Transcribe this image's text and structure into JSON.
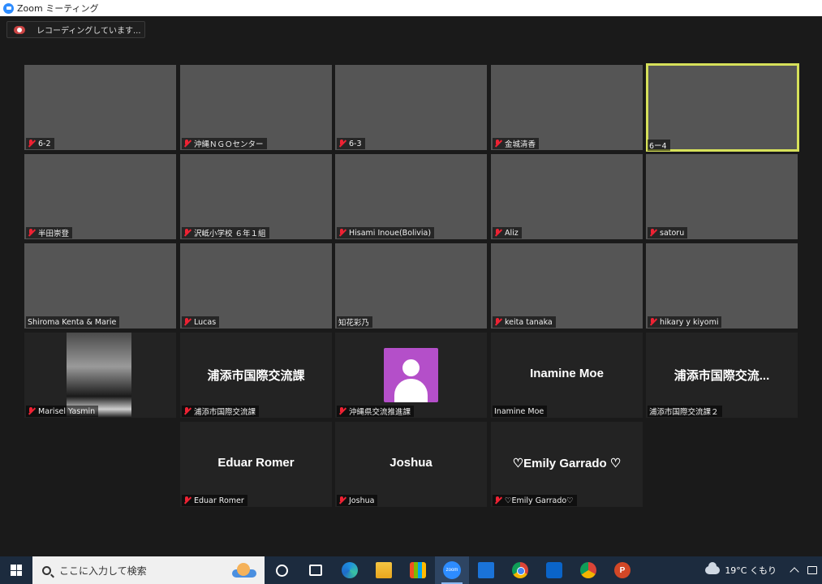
{
  "window": {
    "title": "Zoom ミーティング",
    "recording_status": "レコーディングしています..."
  },
  "tiles": [
    {
      "id": "t1",
      "label": "6-2",
      "type": "video",
      "muted": true
    },
    {
      "id": "t2",
      "label": "沖縄ＮＧＯセンター",
      "type": "video",
      "muted": true
    },
    {
      "id": "t3",
      "label": "6-3",
      "type": "video",
      "muted": true
    },
    {
      "id": "t4",
      "label": "金城清香",
      "type": "video",
      "muted": true
    },
    {
      "id": "t5",
      "label": "6ー4",
      "type": "video",
      "muted": false,
      "active_speaker": true
    },
    {
      "id": "t6",
      "label": "半田崇登",
      "type": "video",
      "muted": true
    },
    {
      "id": "t7",
      "label": "沢岻小学校 ６年１組",
      "type": "video",
      "muted": true
    },
    {
      "id": "t8",
      "label": "Hisami Inoue(Bolivia)",
      "type": "video",
      "muted": true
    },
    {
      "id": "t9",
      "label": "Aliz",
      "type": "video",
      "muted": true
    },
    {
      "id": "t10",
      "label": "satoru",
      "type": "video",
      "muted": true
    },
    {
      "id": "t11",
      "label": "Shiroma Kenta & Marie",
      "type": "video",
      "muted": false
    },
    {
      "id": "t12",
      "label": "Lucas",
      "type": "video",
      "muted": true
    },
    {
      "id": "t13",
      "label": "知花彩乃",
      "type": "video",
      "muted": false
    },
    {
      "id": "t14",
      "label": "keita tanaka",
      "type": "video",
      "muted": true
    },
    {
      "id": "t15",
      "label": "hikary y kiyomi",
      "type": "video",
      "muted": true
    },
    {
      "id": "t16",
      "label": "Marisel Yasmin",
      "type": "video",
      "muted": true
    },
    {
      "id": "t17",
      "label": "浦添市国際交流課",
      "display": "浦添市国際交流課",
      "type": "text",
      "muted": true
    },
    {
      "id": "t18",
      "label": "沖縄県交流推進課",
      "type": "avatar",
      "muted": true
    },
    {
      "id": "t19",
      "label": "Inamine Moe",
      "display": "Inamine Moe",
      "type": "text",
      "muted": false
    },
    {
      "id": "t20",
      "label": "浦添市国際交流課２",
      "display": "浦添市国際交流...",
      "type": "text",
      "muted": false
    },
    {
      "id": "t21",
      "label": "Eduar Romer",
      "display": "Eduar Romer",
      "type": "text",
      "muted": true
    },
    {
      "id": "t22",
      "label": "Joshua",
      "display": "Joshua",
      "type": "text",
      "muted": true
    },
    {
      "id": "t23",
      "label": "♡Emily Garrado♡",
      "display": "♡Emily Garrado ♡",
      "type": "text",
      "muted": true
    }
  ],
  "taskbar": {
    "search_placeholder": "ここに入力して検索",
    "zoom_label": "zoom",
    "ppt_label": "P",
    "weather": "19°C くもり",
    "icons": [
      "windows-start-icon",
      "search-icon",
      "cortana-icon",
      "task-view-icon",
      "edge-icon",
      "file-explorer-icon",
      "store-icon",
      "zoom-icon",
      "mail-icon",
      "chrome-icon",
      "outlook-icon",
      "chrome-profile-icon",
      "powerpoint-icon",
      "cloud-icon"
    ]
  },
  "colors": {
    "active_speaker": "#d6e05a",
    "muted_mic": "#e23333",
    "avatar_bg": "#b44fc9",
    "zoom_blue": "#2d8cff",
    "taskbar_bg": "#1c2b3e"
  }
}
